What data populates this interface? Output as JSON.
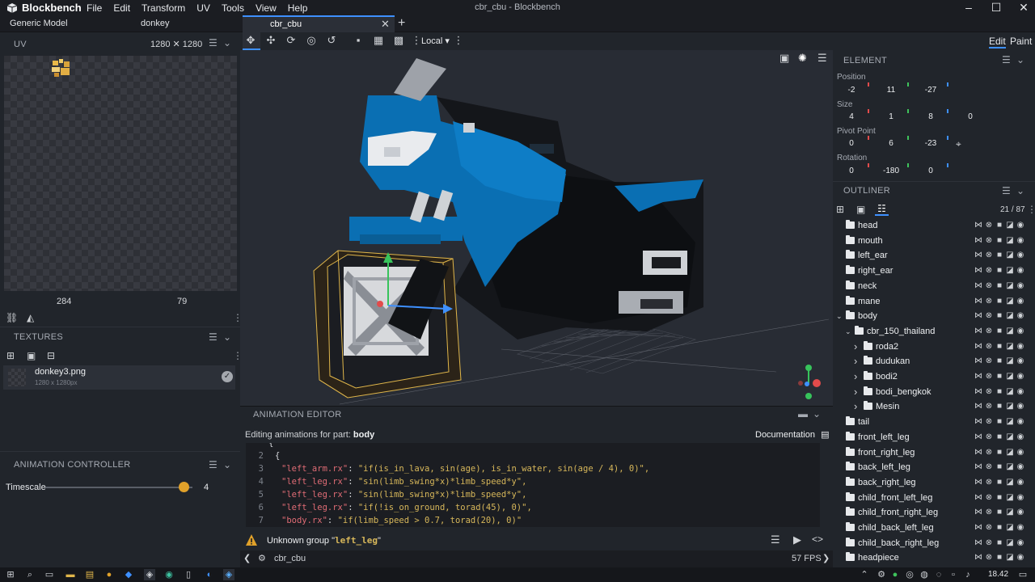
{
  "app": {
    "name": "Blockbench",
    "window_title": "cbr_cbu - Blockbench",
    "menu": [
      "File",
      "Edit",
      "Transform",
      "UV",
      "Tools",
      "View",
      "Help"
    ],
    "window_controls": [
      "–",
      "☐",
      "✕"
    ]
  },
  "tabs": {
    "format": "Generic Model",
    "inactive": "donkey",
    "active": "cbr_cbu"
  },
  "uv_panel": {
    "title": "UV",
    "resolution": "1280 ✕ 1280",
    "x": "284",
    "y": "79"
  },
  "textures": {
    "title": "TEXTURES",
    "items": [
      {
        "name": "donkey3.png",
        "size": "1280 x 1280px"
      }
    ]
  },
  "animation_controller": {
    "title": "ANIMATION CONTROLLER",
    "timescale_label": "Timescale",
    "timescale_value": "4",
    "timescale_fraction": 0.94
  },
  "toolbar": {
    "space": "Local"
  },
  "animation_editor": {
    "title": "ANIMATION EDITOR",
    "editing_prefix": "Editing animations for part:",
    "editing_part": "body",
    "documentation": "Documentation",
    "code_lines": [
      {
        "n": "",
        "key": "",
        "val": "{"
      },
      {
        "n": "2",
        "key": "",
        "val": "{"
      },
      {
        "n": "3",
        "key": "\"left_arm.rx\"",
        "val": "\"if(is_in_lava, sin(age), is_in_water, sin(age / 4), 0)\","
      },
      {
        "n": "4",
        "key": "\"left_leg.rx\"",
        "val": "\"sin(limb_swing*x)*limb_speed*y\","
      },
      {
        "n": "5",
        "key": "\"left_leg.rx\"",
        "val": "\"sin(limb_swing*x)*limb_speed*y\","
      },
      {
        "n": "6",
        "key": "\"left_leg.rx\"",
        "val": "\"if(!is_on_ground, torad(45), 0)\","
      },
      {
        "n": "7",
        "key": "\"body.rx\"",
        "val": "\"if(limb_speed > 0.7, torad(20), 0)\""
      }
    ],
    "warning_prefix": "Unknown group",
    "warning_code": "left_leg",
    "status_name": "cbr_cbu",
    "fps": "57 FPS"
  },
  "element_panel": {
    "modes": [
      "Edit",
      "Paint"
    ],
    "title": "ELEMENT",
    "position_label": "Position",
    "position": [
      "-2",
      "11",
      "-27"
    ],
    "size_label": "Size",
    "size": [
      "4",
      "1",
      "8",
      "0"
    ],
    "pivot_label": "Pivot Point",
    "pivot": [
      "0",
      "6",
      "-23"
    ],
    "rotation_label": "Rotation",
    "rotation": [
      "0",
      "-180",
      "0"
    ]
  },
  "outliner": {
    "title": "OUTLINER",
    "count": "21 / 87",
    "items": [
      {
        "name": "head",
        "depth": 0,
        "arrow": ""
      },
      {
        "name": "mouth",
        "depth": 0,
        "arrow": ""
      },
      {
        "name": "left_ear",
        "depth": 0,
        "arrow": ""
      },
      {
        "name": "right_ear",
        "depth": 0,
        "arrow": ""
      },
      {
        "name": "neck",
        "depth": 0,
        "arrow": ""
      },
      {
        "name": "mane",
        "depth": 0,
        "arrow": ""
      },
      {
        "name": "body",
        "depth": 0,
        "arrow": "down"
      },
      {
        "name": "cbr_150_thailand",
        "depth": 1,
        "arrow": "down"
      },
      {
        "name": "roda2",
        "depth": 2,
        "arrow": "right"
      },
      {
        "name": "dudukan",
        "depth": 2,
        "arrow": "right"
      },
      {
        "name": "bodi2",
        "depth": 2,
        "arrow": "right"
      },
      {
        "name": "bodi_bengkok",
        "depth": 2,
        "arrow": "right"
      },
      {
        "name": "Mesin",
        "depth": 2,
        "arrow": "right"
      },
      {
        "name": "tail",
        "depth": 0,
        "arrow": ""
      },
      {
        "name": "front_left_leg",
        "depth": 0,
        "arrow": ""
      },
      {
        "name": "front_right_leg",
        "depth": 0,
        "arrow": ""
      },
      {
        "name": "back_left_leg",
        "depth": 0,
        "arrow": ""
      },
      {
        "name": "back_right_leg",
        "depth": 0,
        "arrow": ""
      },
      {
        "name": "child_front_left_leg",
        "depth": 0,
        "arrow": ""
      },
      {
        "name": "child_front_right_leg",
        "depth": 0,
        "arrow": ""
      },
      {
        "name": "child_back_left_leg",
        "depth": 0,
        "arrow": ""
      },
      {
        "name": "child_back_right_leg",
        "depth": 0,
        "arrow": ""
      },
      {
        "name": "headpiece",
        "depth": 0,
        "arrow": ""
      }
    ]
  },
  "taskbar": {
    "time": "18.42"
  },
  "colors": {
    "accent": "#3e90ff",
    "warning": "#e0a12a",
    "model_blue": "#0a6fb3"
  }
}
